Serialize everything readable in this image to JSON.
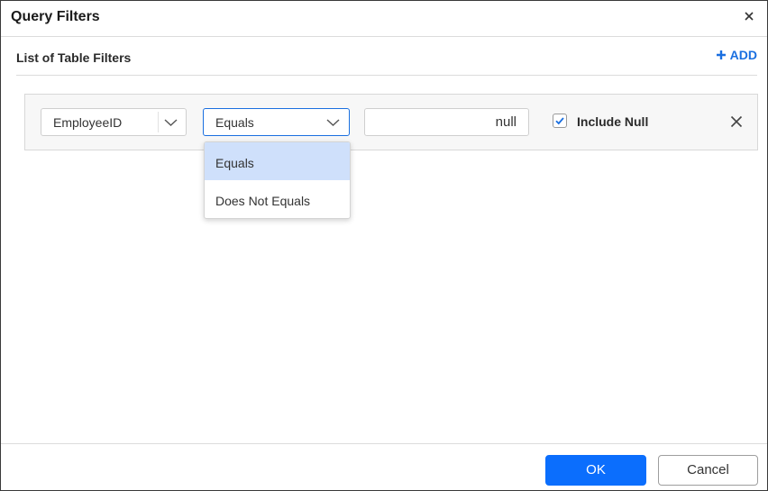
{
  "dialog": {
    "title": "Query Filters"
  },
  "section": {
    "title": "List of Table Filters",
    "add_label": "ADD"
  },
  "filter": {
    "field_value": "EmployeeID",
    "operator_value": "Equals",
    "value_text": "null",
    "include_null_label": "Include Null",
    "include_null_checked": true
  },
  "operator_dropdown": {
    "options": [
      "Equals",
      "Does Not Equals"
    ],
    "highlighted": "Equals"
  },
  "footer": {
    "ok_label": "OK",
    "cancel_label": "Cancel"
  },
  "colors": {
    "accent": "#1a6fe0",
    "ok_button": "#0b6efd",
    "highlight": "#cfe0fb"
  }
}
